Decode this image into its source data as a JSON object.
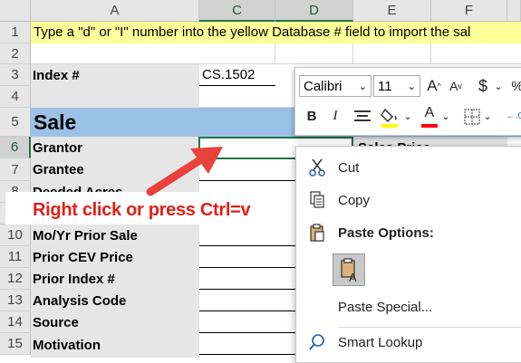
{
  "columns": [
    {
      "label": "A",
      "selected": false
    },
    {
      "label": "C",
      "selected": true
    },
    {
      "label": "D",
      "selected": true
    },
    {
      "label": "E",
      "selected": false
    },
    {
      "label": "F",
      "selected": false
    }
  ],
  "rows": [
    "1",
    "2",
    "3",
    "4",
    "5",
    "6",
    "7",
    "8",
    "9",
    "10",
    "11",
    "12",
    "13",
    "14",
    "15"
  ],
  "instruction": "Type a \"d\" or \"I\" number into the yellow Database # field to import the sal",
  "index": {
    "label": "Index #",
    "value": "CS.1502"
  },
  "section_title": "Sale",
  "sales_price_label": "Sales Price",
  "fields": [
    "Grantor",
    "Grantee",
    "Deeded Acres",
    "Mo/Yr Prior Sale",
    "Prior CEV Price",
    "Prior Index #",
    "Analysis Code",
    "Source",
    "Motivation"
  ],
  "callout": "Right click or press Ctrl=v",
  "mini_toolbar": {
    "font_name": "Calibri",
    "font_size": "11",
    "currency": "$"
  },
  "context_menu": {
    "cut": "Cut",
    "copy": "Copy",
    "paste_options": "Paste Options:",
    "paste_special": "Paste Special...",
    "smart_lookup": "Smart Lookup"
  },
  "colors": {
    "accent": "#217346",
    "section": "#9bc2e6",
    "instruction_bg": "#ffff99",
    "arrow": "#e8423b",
    "label_bg": "#e7e6e6"
  }
}
